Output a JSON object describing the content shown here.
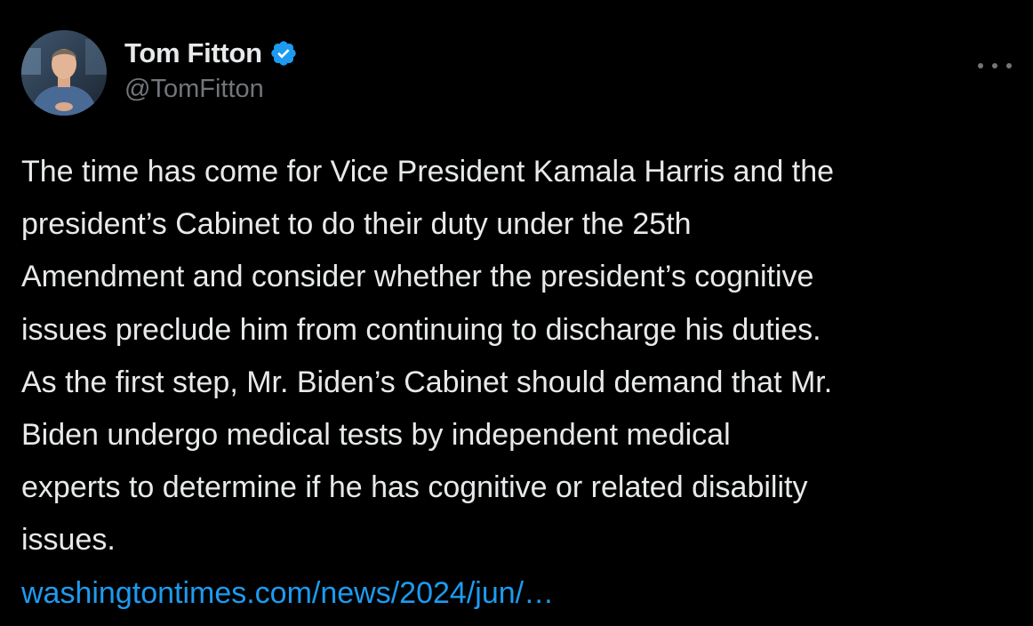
{
  "author": {
    "display_name": "Tom Fitton",
    "handle": "@TomFitton",
    "verified": true,
    "avatar_icon": "avatar-photo"
  },
  "more_icon": "ellipsis-icon",
  "tweet": {
    "lines": [
      "The time has come for Vice President Kamala Harris and the",
      "president’s Cabinet to do their duty under the 25th",
      "Amendment and consider whether the president’s cognitive",
      "issues preclude him from continuing to discharge his duties.",
      "As the first step, Mr. Biden’s Cabinet should demand that Mr.",
      "Biden undergo medical tests by independent medical",
      "experts to determine if he has cognitive or related disability",
      "issues."
    ],
    "link_text": "washingtontimes.com/news/2024/jun/…"
  },
  "colors": {
    "background": "#000000",
    "text": "#e7e9ea",
    "secondary": "#71767b",
    "link": "#1d9bf0",
    "verified_badge": "#1d9bf0"
  }
}
